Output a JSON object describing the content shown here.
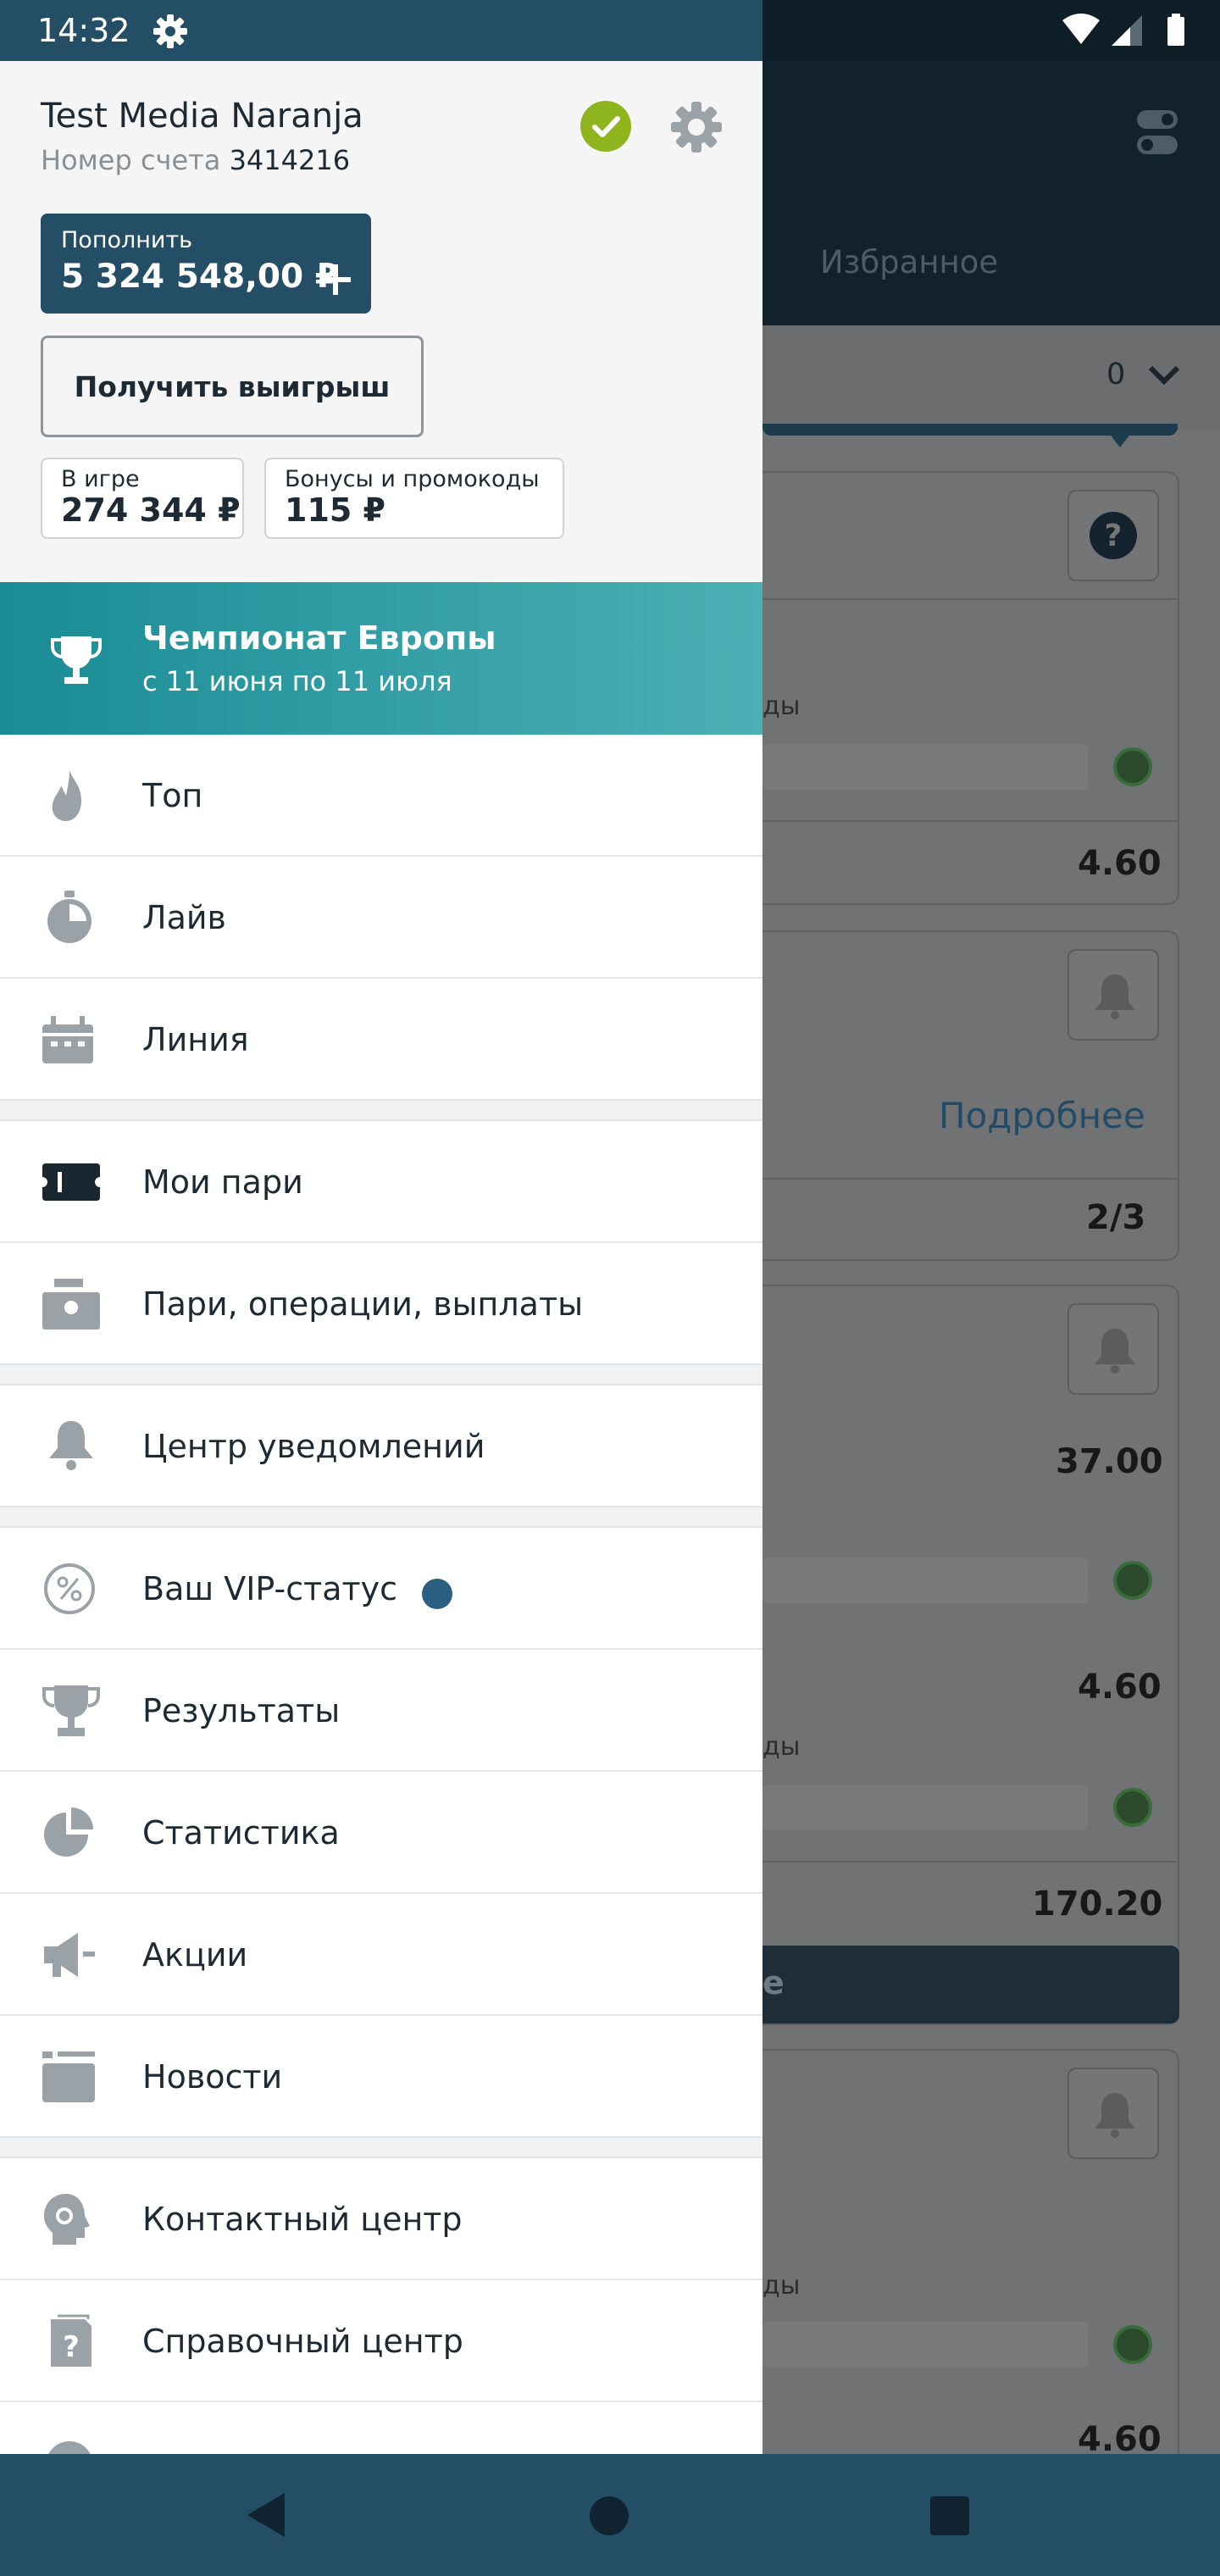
{
  "status_bar": {
    "time": "14:32"
  },
  "background": {
    "tab_favorites": "Избранное",
    "filter_count": "0",
    "card_text_fragment": "ды",
    "odds": [
      "4.60",
      "37.00",
      "4.60",
      "170.20",
      "4.60"
    ],
    "details_link": "Подробнее",
    "fraction": "2/3",
    "dark_button_fragment": "е"
  },
  "profile": {
    "user_name": "Test Media Naranja",
    "account_label": "Номер счета",
    "account_number": "3414216",
    "deposit_label": "Пополнить",
    "balance": "5 324 548,00 ₽",
    "withdraw_label": "Получить выигрыш",
    "in_game_label": "В игре",
    "in_game_value": "274 344 ₽",
    "bonuses_label": "Бонусы и промокоды",
    "bonuses_value": "115 ₽"
  },
  "promo": {
    "title": "Чемпионат Европы",
    "subtitle": "с 11 июня по 11 июля"
  },
  "menu": {
    "top": "Топ",
    "live": "Лайв",
    "line": "Линия",
    "my_bets": "Мои пари",
    "history": "Пари, операции, выплаты",
    "notifications": "Центр уведомлений",
    "vip": "Ваш VIP-статус",
    "results": "Результаты",
    "statistics": "Статистика",
    "promotions": "Акции",
    "news": "Новости",
    "contact": "Контактный центр",
    "help": "Справочный центр"
  },
  "colors": {
    "primary": "#234e66",
    "verified": "#8fb51e",
    "promo_start": "#1a8c95",
    "promo_end": "#4bb0b4",
    "vip_dot": "#2a5f82"
  }
}
